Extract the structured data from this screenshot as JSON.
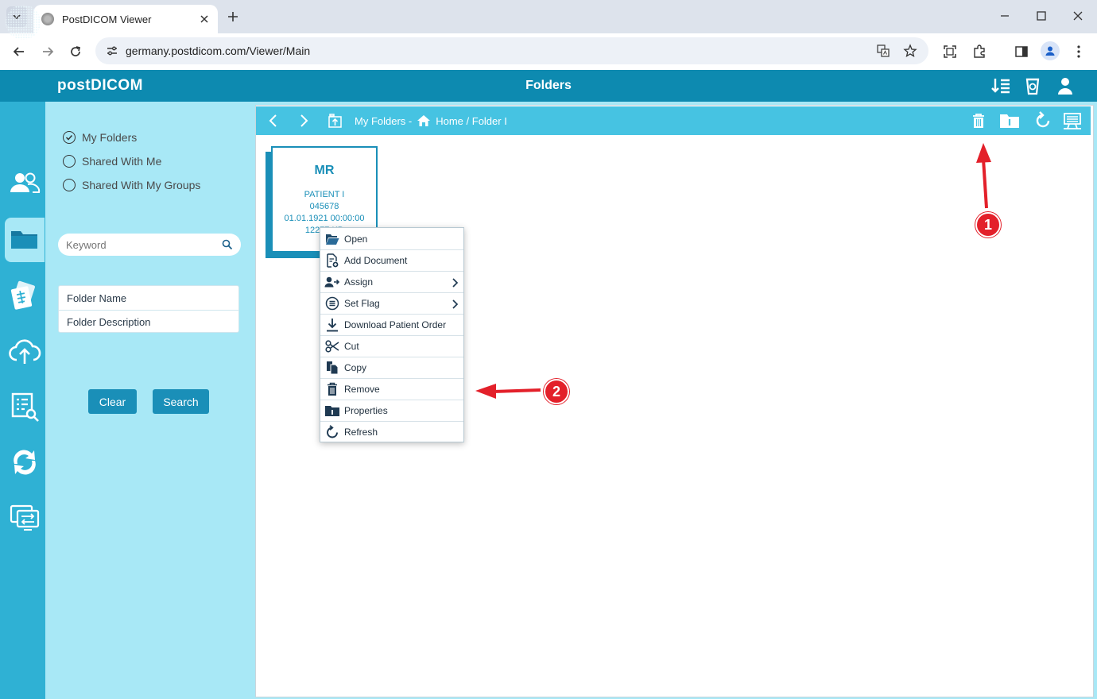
{
  "browser": {
    "tab_title": "PostDICOM Viewer",
    "url": "germany.postdicom.com/Viewer/Main"
  },
  "app": {
    "brand": "postDICOM",
    "header_title": "Folders"
  },
  "filters": {
    "options": [
      "My Folders",
      "Shared With Me",
      "Shared With My Groups"
    ],
    "selected": "My Folders",
    "keyword_placeholder": "Keyword",
    "fields": [
      "Folder Name",
      "Folder Description"
    ],
    "clear_label": "Clear",
    "search_label": "Search"
  },
  "breadcrumb": {
    "root": "My Folders -",
    "path": "Home / Folder I"
  },
  "study_card": {
    "modality": "MR",
    "patient_name": "PATIENT I",
    "patient_id": "045678",
    "date": "01.01.1921 00:00:00",
    "size": "12277 KB"
  },
  "context_menu": {
    "items": [
      "Open",
      "Add Document",
      "Assign",
      "Set Flag",
      "Download Patient Order",
      "Cut",
      "Copy",
      "Remove",
      "Properties",
      "Refresh"
    ],
    "icons": [
      "folder-open-icon",
      "add-document-icon",
      "assign-user-icon",
      "flag-list-icon",
      "download-icon",
      "scissors-icon",
      "copy-icon",
      "trash-icon",
      "folder-info-icon",
      "refresh-icon"
    ]
  },
  "annotations": {
    "marker1": "1",
    "marker2": "2"
  },
  "colors": {
    "header": "#0d8ab0",
    "rail": "#2fb1d4",
    "panel": "#a8e8f6",
    "path_bar": "#46c3e2",
    "accent": "#1a8fb8",
    "annotation": "#e3202a"
  }
}
